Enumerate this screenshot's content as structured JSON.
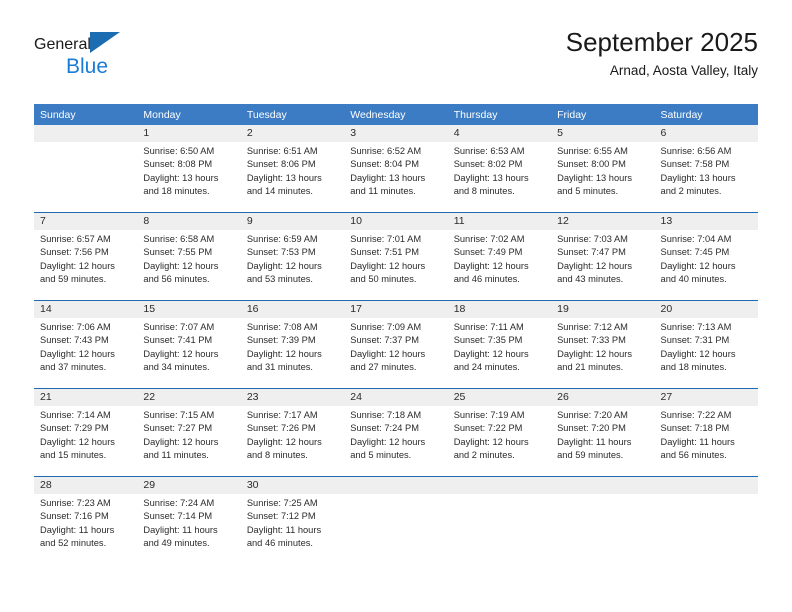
{
  "brand": {
    "name_dark": "General",
    "name_blue": "Blue",
    "accent_blue": "#1b7cd6",
    "triangle_blue": "#1b6cb0"
  },
  "header": {
    "title": "September 2025",
    "location": "Arnad, Aosta Valley, Italy"
  },
  "theme": {
    "header_bg": "#3b7cc4",
    "header_text": "#ffffff",
    "daynum_band_bg": "#efefef",
    "row_separator": "#1f6bb0",
    "cell_bg": "#ffffff",
    "body_text": "#2b2b2b"
  },
  "weekdays": [
    "Sunday",
    "Monday",
    "Tuesday",
    "Wednesday",
    "Thursday",
    "Friday",
    "Saturday"
  ],
  "weeks": [
    [
      {
        "day": "",
        "sunrise": "",
        "sunset": "",
        "daylight_1": "",
        "daylight_2": ""
      },
      {
        "day": "1",
        "sunrise": "Sunrise: 6:50 AM",
        "sunset": "Sunset: 8:08 PM",
        "daylight_1": "Daylight: 13 hours",
        "daylight_2": "and 18 minutes."
      },
      {
        "day": "2",
        "sunrise": "Sunrise: 6:51 AM",
        "sunset": "Sunset: 8:06 PM",
        "daylight_1": "Daylight: 13 hours",
        "daylight_2": "and 14 minutes."
      },
      {
        "day": "3",
        "sunrise": "Sunrise: 6:52 AM",
        "sunset": "Sunset: 8:04 PM",
        "daylight_1": "Daylight: 13 hours",
        "daylight_2": "and 11 minutes."
      },
      {
        "day": "4",
        "sunrise": "Sunrise: 6:53 AM",
        "sunset": "Sunset: 8:02 PM",
        "daylight_1": "Daylight: 13 hours",
        "daylight_2": "and 8 minutes."
      },
      {
        "day": "5",
        "sunrise": "Sunrise: 6:55 AM",
        "sunset": "Sunset: 8:00 PM",
        "daylight_1": "Daylight: 13 hours",
        "daylight_2": "and 5 minutes."
      },
      {
        "day": "6",
        "sunrise": "Sunrise: 6:56 AM",
        "sunset": "Sunset: 7:58 PM",
        "daylight_1": "Daylight: 13 hours",
        "daylight_2": "and 2 minutes."
      }
    ],
    [
      {
        "day": "7",
        "sunrise": "Sunrise: 6:57 AM",
        "sunset": "Sunset: 7:56 PM",
        "daylight_1": "Daylight: 12 hours",
        "daylight_2": "and 59 minutes."
      },
      {
        "day": "8",
        "sunrise": "Sunrise: 6:58 AM",
        "sunset": "Sunset: 7:55 PM",
        "daylight_1": "Daylight: 12 hours",
        "daylight_2": "and 56 minutes."
      },
      {
        "day": "9",
        "sunrise": "Sunrise: 6:59 AM",
        "sunset": "Sunset: 7:53 PM",
        "daylight_1": "Daylight: 12 hours",
        "daylight_2": "and 53 minutes."
      },
      {
        "day": "10",
        "sunrise": "Sunrise: 7:01 AM",
        "sunset": "Sunset: 7:51 PM",
        "daylight_1": "Daylight: 12 hours",
        "daylight_2": "and 50 minutes."
      },
      {
        "day": "11",
        "sunrise": "Sunrise: 7:02 AM",
        "sunset": "Sunset: 7:49 PM",
        "daylight_1": "Daylight: 12 hours",
        "daylight_2": "and 46 minutes."
      },
      {
        "day": "12",
        "sunrise": "Sunrise: 7:03 AM",
        "sunset": "Sunset: 7:47 PM",
        "daylight_1": "Daylight: 12 hours",
        "daylight_2": "and 43 minutes."
      },
      {
        "day": "13",
        "sunrise": "Sunrise: 7:04 AM",
        "sunset": "Sunset: 7:45 PM",
        "daylight_1": "Daylight: 12 hours",
        "daylight_2": "and 40 minutes."
      }
    ],
    [
      {
        "day": "14",
        "sunrise": "Sunrise: 7:06 AM",
        "sunset": "Sunset: 7:43 PM",
        "daylight_1": "Daylight: 12 hours",
        "daylight_2": "and 37 minutes."
      },
      {
        "day": "15",
        "sunrise": "Sunrise: 7:07 AM",
        "sunset": "Sunset: 7:41 PM",
        "daylight_1": "Daylight: 12 hours",
        "daylight_2": "and 34 minutes."
      },
      {
        "day": "16",
        "sunrise": "Sunrise: 7:08 AM",
        "sunset": "Sunset: 7:39 PM",
        "daylight_1": "Daylight: 12 hours",
        "daylight_2": "and 31 minutes."
      },
      {
        "day": "17",
        "sunrise": "Sunrise: 7:09 AM",
        "sunset": "Sunset: 7:37 PM",
        "daylight_1": "Daylight: 12 hours",
        "daylight_2": "and 27 minutes."
      },
      {
        "day": "18",
        "sunrise": "Sunrise: 7:11 AM",
        "sunset": "Sunset: 7:35 PM",
        "daylight_1": "Daylight: 12 hours",
        "daylight_2": "and 24 minutes."
      },
      {
        "day": "19",
        "sunrise": "Sunrise: 7:12 AM",
        "sunset": "Sunset: 7:33 PM",
        "daylight_1": "Daylight: 12 hours",
        "daylight_2": "and 21 minutes."
      },
      {
        "day": "20",
        "sunrise": "Sunrise: 7:13 AM",
        "sunset": "Sunset: 7:31 PM",
        "daylight_1": "Daylight: 12 hours",
        "daylight_2": "and 18 minutes."
      }
    ],
    [
      {
        "day": "21",
        "sunrise": "Sunrise: 7:14 AM",
        "sunset": "Sunset: 7:29 PM",
        "daylight_1": "Daylight: 12 hours",
        "daylight_2": "and 15 minutes."
      },
      {
        "day": "22",
        "sunrise": "Sunrise: 7:15 AM",
        "sunset": "Sunset: 7:27 PM",
        "daylight_1": "Daylight: 12 hours",
        "daylight_2": "and 11 minutes."
      },
      {
        "day": "23",
        "sunrise": "Sunrise: 7:17 AM",
        "sunset": "Sunset: 7:26 PM",
        "daylight_1": "Daylight: 12 hours",
        "daylight_2": "and 8 minutes."
      },
      {
        "day": "24",
        "sunrise": "Sunrise: 7:18 AM",
        "sunset": "Sunset: 7:24 PM",
        "daylight_1": "Daylight: 12 hours",
        "daylight_2": "and 5 minutes."
      },
      {
        "day": "25",
        "sunrise": "Sunrise: 7:19 AM",
        "sunset": "Sunset: 7:22 PM",
        "daylight_1": "Daylight: 12 hours",
        "daylight_2": "and 2 minutes."
      },
      {
        "day": "26",
        "sunrise": "Sunrise: 7:20 AM",
        "sunset": "Sunset: 7:20 PM",
        "daylight_1": "Daylight: 11 hours",
        "daylight_2": "and 59 minutes."
      },
      {
        "day": "27",
        "sunrise": "Sunrise: 7:22 AM",
        "sunset": "Sunset: 7:18 PM",
        "daylight_1": "Daylight: 11 hours",
        "daylight_2": "and 56 minutes."
      }
    ],
    [
      {
        "day": "28",
        "sunrise": "Sunrise: 7:23 AM",
        "sunset": "Sunset: 7:16 PM",
        "daylight_1": "Daylight: 11 hours",
        "daylight_2": "and 52 minutes."
      },
      {
        "day": "29",
        "sunrise": "Sunrise: 7:24 AM",
        "sunset": "Sunset: 7:14 PM",
        "daylight_1": "Daylight: 11 hours",
        "daylight_2": "and 49 minutes."
      },
      {
        "day": "30",
        "sunrise": "Sunrise: 7:25 AM",
        "sunset": "Sunset: 7:12 PM",
        "daylight_1": "Daylight: 11 hours",
        "daylight_2": "and 46 minutes."
      },
      {
        "day": "",
        "sunrise": "",
        "sunset": "",
        "daylight_1": "",
        "daylight_2": ""
      },
      {
        "day": "",
        "sunrise": "",
        "sunset": "",
        "daylight_1": "",
        "daylight_2": ""
      },
      {
        "day": "",
        "sunrise": "",
        "sunset": "",
        "daylight_1": "",
        "daylight_2": ""
      },
      {
        "day": "",
        "sunrise": "",
        "sunset": "",
        "daylight_1": "",
        "daylight_2": ""
      }
    ]
  ]
}
